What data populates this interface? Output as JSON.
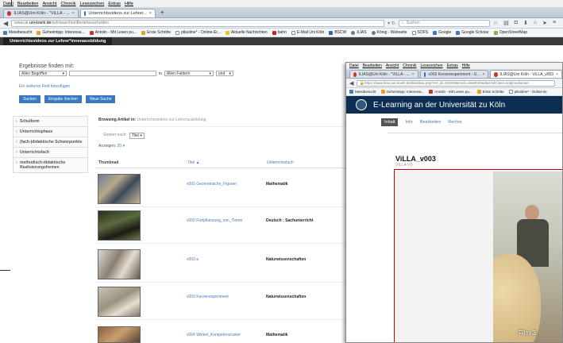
{
  "main_browser": {
    "menu": [
      "Datei",
      "Bearbeiten",
      "Ansicht",
      "Chronik",
      "Lesezeichen",
      "Extras",
      "Hilfe"
    ],
    "tabs": [
      {
        "label": "ILIAS@Uni Köln - \"ViLLA - ...",
        "active": false
      },
      {
        "label": "Unterrichtsvideos zur Lehrer...",
        "active": true
      }
    ],
    "url_prefix": "www.uk-",
    "url_domain": "uni-koeln.de",
    "url_path": "/ssh/search/unflexiertesuchvideo",
    "search_placeholder": "Suchen",
    "bookmarks": [
      "Meistbesucht",
      "Geheimtipp: Interessa...",
      "Antolin - Mit Lesen pu...",
      "Erste Schritte",
      "ptlusline* - Online-Er...",
      "Aktuelle Nachrichten",
      "bahn",
      "E-Mail Uni Köln",
      "BSCW",
      "ILIAS",
      "König - Webseite",
      "SOFS",
      "Google",
      "Google Scholar",
      "OpenStreetMap"
    ]
  },
  "site": {
    "title": "Unterrichtsvideos zur Lehrer*innenausbildung",
    "search_heading": "Ergebnisse finden mit:",
    "field1": "Allen Begriffen",
    "in_label": "in",
    "field2": "Allen Feldern",
    "op": "und",
    "more_link": "Ein weiteres Feld hinzufügen",
    "buttons": {
      "search": "Suchen",
      "reset": "Eingabe löschen",
      "new": "Neue Suche"
    },
    "facets": [
      "Schulform",
      "Unterrichtsphase",
      "(fach-)didaktische Schwerpunkte",
      "Unterrichtsfach",
      "methodisch-didaktische Realisierungsformen"
    ],
    "browsing_label": "Browsing Artikel in:",
    "browsing_value": "Unterrichtsvideos zur Lehrerausbildung",
    "sort_label": "Sortiert nach:",
    "sort_value": "Titel",
    "show_label": "Anzeigen:",
    "show_value": "20",
    "col_thumb": "Thumbnail",
    "col_title": "Titel",
    "col_subject": "Unterrichtsfach",
    "rows": [
      {
        "title": "v001 Geometrische_Figuren",
        "subject": "Mathematik"
      },
      {
        "title": "v002 Fortpflanzung_von_Tieren",
        "subject": "Deutsch ; Sachunterricht"
      },
      {
        "title": "v003 a",
        "subject": "Naturwissenschaften"
      },
      {
        "title": "v003 Kerzenexperiment",
        "subject": "Naturwissenschaften"
      },
      {
        "title": "v004 Winkel_Kompetenzraster",
        "subject": "Mathematik"
      }
    ]
  },
  "second_browser": {
    "menu": [
      "Datei",
      "Bearbeiten",
      "Ansicht",
      "Chronik",
      "Lesezeichen",
      "Extras",
      "Hilfe"
    ],
    "tabs": [
      {
        "label": "ILIAS@Uni Köln - \"ViLLA - ...",
        "active": false
      },
      {
        "label": "v003 Kerzenexperiment - U...",
        "active": false
      },
      {
        "label": "ILIAS@Uni Köln - ViLLA_v003",
        "active": true
      }
    ],
    "url": "https://www.ilias.uni-koeln.de/ilias/ilias.php?ref_id=2202058cmd=viewEmbed&cmdClass=ilobjmediacast",
    "bookmarks": [
      "Meistbesucht",
      "Geheimtipp: Interessa...",
      "Antolin - Mit Lesen pu...",
      "Erste Schritte",
      "ptlusline* - Online-Er"
    ],
    "header": "E-Learning an der Universität zu Köln",
    "tabs2": [
      "Inhalt",
      "Info",
      "Bearbeiten",
      "Rechte"
    ],
    "title": "ViLLA_v003",
    "subtitle": "VILLA-V0",
    "video_label": "Film 3"
  }
}
